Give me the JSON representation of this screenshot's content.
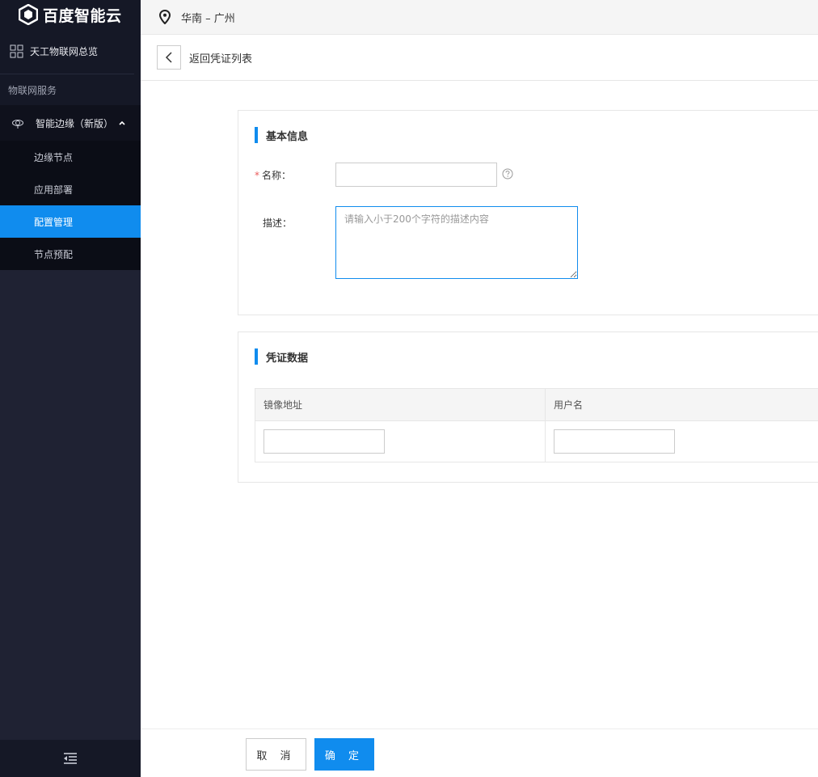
{
  "brand": {
    "name": "百度智能云",
    "logo_icon": "baidu-cloud-logo-icon"
  },
  "sidebar": {
    "overview_label": "天工物联网总览",
    "section_label": "物联网服务",
    "group": {
      "label": "智能边缘（新版）",
      "expanded": true
    },
    "items": [
      {
        "label": "边缘节点",
        "active": false
      },
      {
        "label": "应用部署",
        "active": false
      },
      {
        "label": "配置管理",
        "active": true
      },
      {
        "label": "节点预配",
        "active": false
      }
    ]
  },
  "topbar": {
    "region": "华南 – 广州"
  },
  "header": {
    "back_label": "返回凭证列表"
  },
  "basic_info": {
    "title": "基本信息",
    "name_label": "名称：",
    "name_value": "",
    "desc_label": "描述：",
    "desc_placeholder": "请输入小于200个字符的描述内容"
  },
  "credential_data": {
    "title": "凭证数据",
    "columns": [
      "镜像地址",
      "用户名"
    ]
  },
  "footer": {
    "cancel_label": "取 消",
    "confirm_label": "确 定"
  },
  "colors": {
    "accent": "#108cee",
    "sidebar_bg": "#1f2233",
    "required": "#eb5b5b"
  }
}
